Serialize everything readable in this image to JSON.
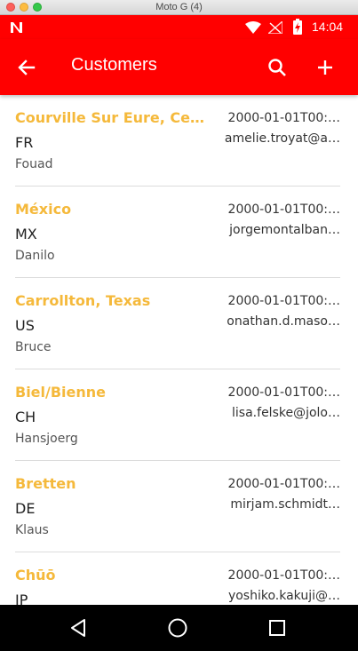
{
  "window": {
    "title": "Moto G (4)"
  },
  "status_bar": {
    "time": "14:04"
  },
  "app_bar": {
    "title": "Customers"
  },
  "customers": [
    {
      "city": "Courville Sur Eure, Cen…",
      "country": "FR",
      "first_name": "Fouad",
      "date": "2000-01-01T00:…",
      "email": "amelie.troyat@a…"
    },
    {
      "city": "México",
      "country": "MX",
      "first_name": "Danilo",
      "date": "2000-01-01T00:…",
      "email": "jorgemontalban…"
    },
    {
      "city": "Carrollton, Texas",
      "country": "US",
      "first_name": "Bruce",
      "date": "2000-01-01T00:…",
      "email": "onathan.d.maso…"
    },
    {
      "city": "Biel/Bienne",
      "country": "CH",
      "first_name": "Hansjoerg",
      "date": "2000-01-01T00:…",
      "email": "lisa.felske@jolo…"
    },
    {
      "city": "Bretten",
      "country": "DE",
      "first_name": "Klaus",
      "date": "2000-01-01T00:…",
      "email": "mirjam.schmidt…"
    },
    {
      "city": "Chūō",
      "country": "JP",
      "first_name": "",
      "date": "2000-01-01T00:…",
      "email": "yoshiko.kakuji@…"
    }
  ],
  "colors": {
    "accent": "#ff0000",
    "city_text": "#f5b93b"
  }
}
